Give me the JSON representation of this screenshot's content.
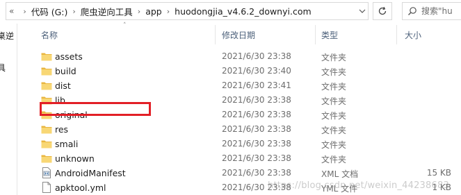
{
  "address_bar": {
    "overflow": "«",
    "crumbs": [
      "代码 (G:)",
      "爬虫逆向工具",
      "app",
      "huodongjia_v4.6.2_downyi.com"
    ]
  },
  "search": {
    "placeholder": "搜索\"hu"
  },
  "nav_pane": {
    "items": [
      "桌逆",
      "具"
    ]
  },
  "columns": {
    "name": "名称",
    "date": "修改日期",
    "type": "类型",
    "size": "大小"
  },
  "files": [
    {
      "name": "assets",
      "date": "2021/6/30 23:38",
      "type": "文件夹",
      "size": "",
      "kind": "folder"
    },
    {
      "name": "build",
      "date": "2021/6/30 23:40",
      "type": "文件夹",
      "size": "",
      "kind": "folder"
    },
    {
      "name": "dist",
      "date": "2021/6/30 23:41",
      "type": "文件夹",
      "size": "",
      "kind": "folder"
    },
    {
      "name": "lib",
      "date": "2021/6/30 23:38",
      "type": "文件夹",
      "size": "",
      "kind": "folder"
    },
    {
      "name": "original",
      "date": "2021/6/30 23:38",
      "type": "文件夹",
      "size": "",
      "kind": "folder"
    },
    {
      "name": "res",
      "date": "2021/6/30 23:38",
      "type": "文件夹",
      "size": "",
      "kind": "folder"
    },
    {
      "name": "smali",
      "date": "2021/6/30 23:38",
      "type": "文件夹",
      "size": "",
      "kind": "folder"
    },
    {
      "name": "unknown",
      "date": "2021/6/30 23:38",
      "type": "文件夹",
      "size": "",
      "kind": "folder"
    },
    {
      "name": "AndroidManifest",
      "date": "2021/6/30 23:38",
      "type": "XML 文档",
      "size": "15 KB",
      "kind": "xml"
    },
    {
      "name": "apktool.yml",
      "date": "2021/6/30 23:38",
      "type": "YML 文件",
      "size": "1 KB",
      "kind": "yml"
    }
  ],
  "watermark": "https://blog.csdn.net/weixin_44238683",
  "colors": {
    "highlight": "#e21f26",
    "folder": "#f8d775",
    "header_text": "#4c607a"
  }
}
